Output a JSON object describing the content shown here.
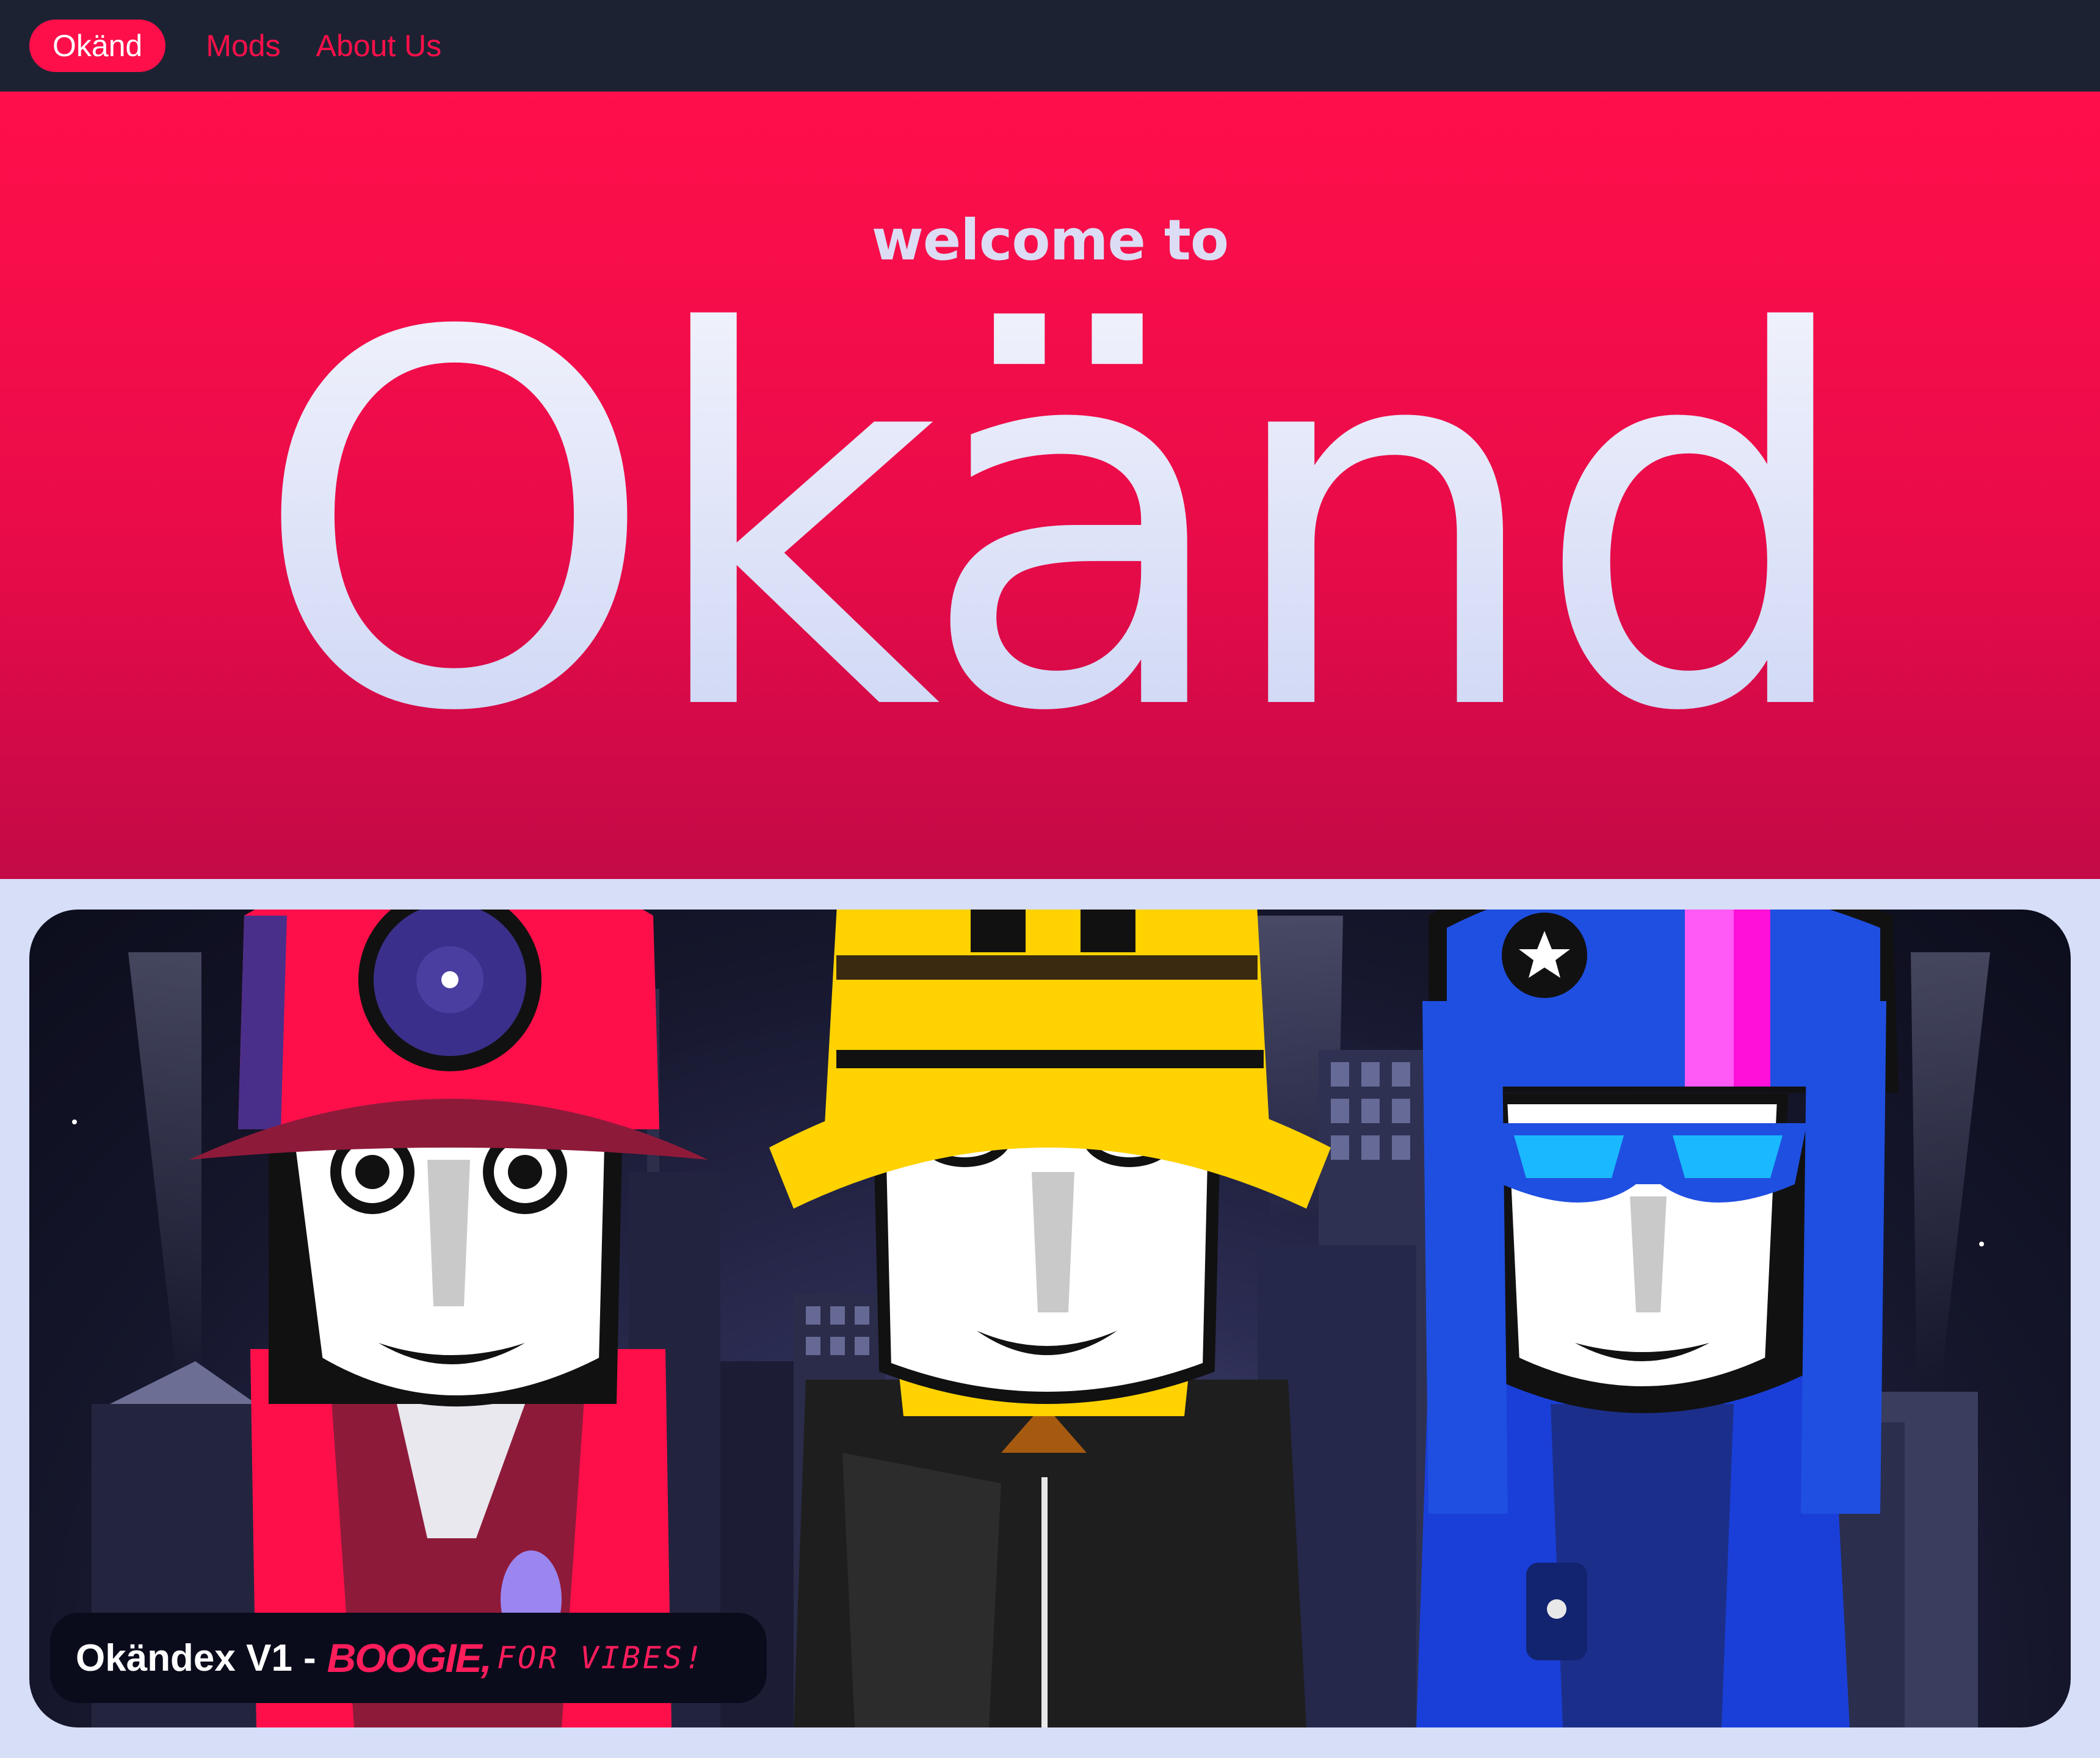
{
  "nav": {
    "items": [
      {
        "label": "Okänd",
        "active": true
      },
      {
        "label": "Mods",
        "active": false
      },
      {
        "label": "About Us",
        "active": false
      }
    ]
  },
  "hero": {
    "welcome": "welcome to",
    "title": "Okänd"
  },
  "card": {
    "caption": {
      "name": "Okändex V1",
      "separator": "-",
      "highlight": "BOOGIE,",
      "tagline": "FOR VIBES!"
    }
  },
  "colors": {
    "accent": "#ff0f4a",
    "nav_bg": "#1d2232",
    "page_bg": "#d7def7",
    "hero_title": "#e6e9fa"
  }
}
